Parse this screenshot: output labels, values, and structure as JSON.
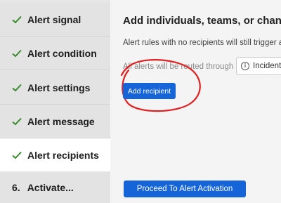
{
  "sidebar": {
    "steps": [
      {
        "label": "Alert signal",
        "status": "complete"
      },
      {
        "label": "Alert condition",
        "status": "complete"
      },
      {
        "label": "Alert settings",
        "status": "complete"
      },
      {
        "label": "Alert message",
        "status": "complete"
      },
      {
        "label": "Alert recipients",
        "status": "complete"
      },
      {
        "number": "6.",
        "label": "Activate...",
        "status": "pending"
      }
    ]
  },
  "main": {
    "heading": "Add individuals, teams, or channels",
    "description": "Alert rules with no recipients will still trigger al",
    "routing_text": "All alerts will be routed through",
    "routing_chip": "Incident",
    "add_recipient_label": "Add recipient",
    "proceed_label": "Proceed To Alert Activation"
  },
  "colors": {
    "check": "#3a8a2e",
    "primary_button": "#1565d8",
    "annotation": "#e02020"
  }
}
